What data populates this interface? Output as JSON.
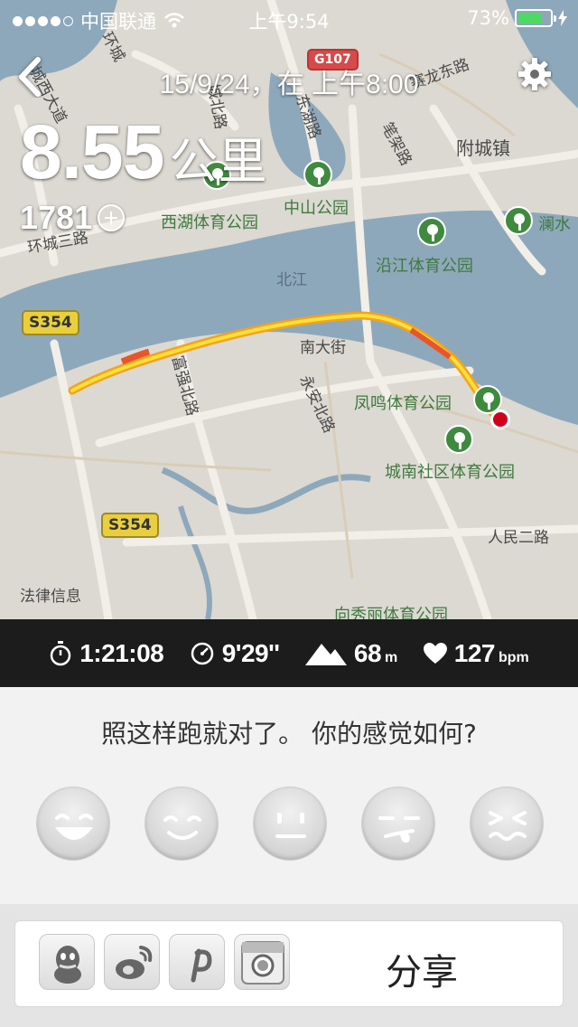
{
  "status_bar": {
    "carrier": "中国联通",
    "time": "上午9:54",
    "battery": "73%",
    "battery_level": 0.73
  },
  "header": {
    "date": "15/9/24，在 上午8:00",
    "distance_value": "8.55",
    "distance_unit": "公里",
    "fuel": "1781"
  },
  "map": {
    "road_labels": [
      "城西大道",
      "环城",
      "城北路",
      "东湖路",
      "G107",
      "赛龙东路",
      "笔架路",
      "附城镇",
      "环城三路",
      "北江",
      "南大街",
      "富强北路",
      "永安北路",
      "S354",
      "S354",
      "人民二路",
      "法律信息",
      "向秀丽体育公园"
    ],
    "parks": [
      "西湖体育公园",
      "中山公园",
      "沿江体育公园",
      "澜水",
      "凤鸣体育公园",
      "城南社区体育公园"
    ]
  },
  "stats": {
    "duration": "1:21:08",
    "pace": "9'29''",
    "elevation": "68",
    "elevation_unit": "m",
    "heart_rate": "127",
    "heart_rate_unit": "bpm"
  },
  "feeling": {
    "question": "照这样跑就对了。 你的感觉如何?",
    "faces": [
      "great",
      "good",
      "neutral",
      "meh",
      "bad"
    ]
  },
  "share": {
    "label": "分享",
    "icons": [
      "qq-icon",
      "weibo-icon",
      "pinterest-icon",
      "instagram-icon"
    ]
  }
}
